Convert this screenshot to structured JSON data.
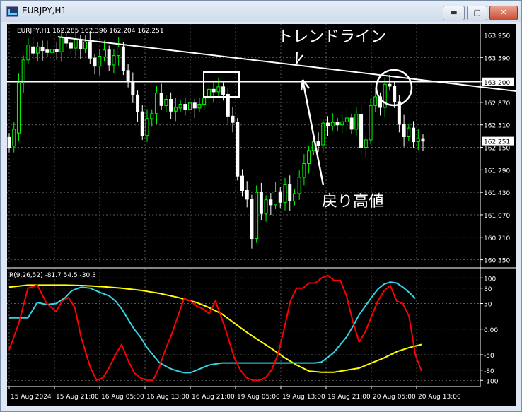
{
  "window": {
    "title": "EURJPY,H1",
    "min_symbol": "▬",
    "max_symbol": "▢",
    "close_symbol": "✕"
  },
  "colors": {
    "background": "#000000",
    "grid": "#7d7d7d",
    "bull": "#00ff00",
    "bear": "#ffffff",
    "line": "#ffffff",
    "red": "#ff0000",
    "cyan": "#33d6e6",
    "yellow": "#ffff00"
  },
  "chart": {
    "info": "EURJPY,H1  162.285 162.396 162.204 162.251",
    "price_ticks": [
      "163.950",
      "163.590",
      "163.200",
      "162.870",
      "162.510",
      "162.251",
      "162.150",
      "161.790",
      "161.430",
      "161.070",
      "160.710",
      "160.350"
    ],
    "annotations": {
      "trendline_label": "トレンドライン",
      "pullback_label": "戻り高値"
    }
  },
  "indicator": {
    "info": "R(9,26,52) -81.7 54.5 -30.3",
    "ticks": [
      "100",
      "80",
      "50",
      "0.00",
      "-50",
      "-80",
      "-100"
    ]
  },
  "time_axis": {
    "labels": [
      "15 Aug 2024",
      "15 Aug 21:00",
      "16 Aug 05:00",
      "16 Aug 13:00",
      "16 Aug 21:00",
      "19 Aug 05:00",
      "19 Aug 13:00",
      "19 Aug 21:00",
      "20 Aug 05:00",
      "20 Aug 13:00"
    ]
  },
  "chart_data": {
    "type": "candlestick",
    "symbol": "EURJPY",
    "timeframe": "H1",
    "last_price": 162.251,
    "levels": [
      163.2
    ],
    "candles": [
      [
        162.31,
        162.14
      ],
      [
        162.17,
        162.44
      ],
      [
        162.38,
        163.18
      ],
      [
        163.18,
        163.55
      ],
      [
        163.55,
        163.79
      ],
      [
        163.76,
        163.66
      ],
      [
        163.66,
        163.76
      ],
      [
        163.75,
        163.7
      ],
      [
        163.71,
        163.67
      ],
      [
        163.67,
        163.72
      ],
      [
        163.72,
        163.68
      ],
      [
        163.68,
        163.92
      ],
      [
        163.91,
        163.82
      ],
      [
        163.82,
        163.74
      ],
      [
        163.74,
        163.88
      ],
      [
        163.88,
        163.73
      ],
      [
        163.73,
        163.84
      ],
      [
        163.84,
        163.58
      ],
      [
        163.58,
        163.45
      ],
      [
        163.45,
        163.61
      ],
      [
        163.6,
        163.71
      ],
      [
        163.71,
        163.47
      ],
      [
        163.47,
        163.62
      ],
      [
        163.62,
        163.76
      ],
      [
        163.76,
        163.38
      ],
      [
        163.38,
        163.21
      ],
      [
        163.2,
        162.99
      ],
      [
        162.99,
        162.72
      ],
      [
        162.72,
        162.34
      ],
      [
        162.34,
        162.61
      ],
      [
        162.61,
        162.69
      ],
      [
        162.69,
        163.02
      ],
      [
        163.02,
        162.82
      ],
      [
        162.82,
        162.92
      ],
      [
        162.92,
        162.73
      ],
      [
        162.73,
        162.79
      ],
      [
        162.78,
        162.84
      ],
      [
        162.84,
        162.76
      ],
      [
        162.76,
        162.86
      ],
      [
        162.86,
        162.78
      ],
      [
        162.78,
        162.84
      ],
      [
        162.84,
        162.94
      ],
      [
        162.94,
        163.08
      ],
      [
        163.08,
        163.04
      ],
      [
        163.04,
        163.12
      ],
      [
        163.12,
        163.0
      ],
      [
        163.0,
        162.65
      ],
      [
        162.65,
        162.55
      ],
      [
        162.55,
        161.69
      ],
      [
        161.69,
        161.46
      ],
      [
        161.46,
        161.32
      ],
      [
        161.32,
        160.69
      ],
      [
        160.69,
        161.43
      ],
      [
        161.43,
        161.09
      ],
      [
        161.09,
        161.31
      ],
      [
        161.31,
        161.23
      ],
      [
        161.23,
        161.44
      ],
      [
        161.44,
        161.27
      ],
      [
        161.27,
        161.55
      ],
      [
        161.55,
        161.29
      ],
      [
        161.29,
        161.41
      ],
      [
        161.41,
        161.67
      ],
      [
        161.67,
        161.89
      ],
      [
        161.89,
        162.1
      ],
      [
        162.1,
        162.24
      ],
      [
        162.24,
        162.18
      ],
      [
        162.19,
        162.54
      ],
      [
        162.54,
        162.49
      ],
      [
        162.49,
        162.55
      ],
      [
        162.55,
        162.51
      ],
      [
        162.51,
        162.56
      ],
      [
        162.56,
        162.62
      ],
      [
        162.62,
        162.44
      ],
      [
        162.44,
        162.68
      ],
      [
        162.68,
        162.15
      ],
      [
        162.15,
        162.27
      ],
      [
        162.27,
        162.82
      ],
      [
        162.82,
        162.96
      ],
      [
        162.96,
        162.79
      ],
      [
        162.79,
        163.16
      ],
      [
        163.16,
        163.13
      ],
      [
        163.13,
        162.88
      ],
      [
        162.88,
        162.52
      ],
      [
        162.52,
        162.32
      ],
      [
        162.32,
        162.46
      ],
      [
        162.46,
        162.24
      ],
      [
        162.24,
        162.29
      ],
      [
        162.29,
        162.25
      ]
    ],
    "trendline": {
      "from": [
        0.1,
        163.92
      ],
      "to": [
        1.0,
        163.05
      ]
    },
    "indicator": {
      "name": "R(9,26,52)",
      "values": {
        "r9": -81.7,
        "r26": 54.5,
        "r52": -30.3
      },
      "red": [
        [
          0,
          -40
        ],
        [
          3,
          10
        ],
        [
          6,
          80
        ],
        [
          9,
          86
        ],
        [
          12,
          50
        ],
        [
          15,
          35
        ],
        [
          17,
          55
        ],
        [
          19,
          62
        ],
        [
          21,
          42
        ],
        [
          23,
          -15
        ],
        [
          26,
          -75
        ],
        [
          28,
          -100
        ],
        [
          30,
          -95
        ],
        [
          32,
          -75
        ],
        [
          34,
          -50
        ],
        [
          36,
          -30
        ],
        [
          38,
          -60
        ],
        [
          40,
          -85
        ],
        [
          42,
          -95
        ],
        [
          44,
          -100
        ],
        [
          46,
          -100
        ],
        [
          48,
          -75
        ],
        [
          50,
          -40
        ],
        [
          52,
          -10
        ],
        [
          54,
          25
        ],
        [
          56,
          60
        ],
        [
          58,
          55
        ],
        [
          60,
          45
        ],
        [
          62,
          40
        ],
        [
          64,
          30
        ],
        [
          66,
          55
        ],
        [
          68,
          22
        ],
        [
          70,
          -15
        ],
        [
          72,
          -55
        ],
        [
          74,
          -80
        ],
        [
          76,
          -95
        ],
        [
          78,
          -100
        ],
        [
          80,
          -100
        ],
        [
          82,
          -95
        ],
        [
          84,
          -80
        ],
        [
          86,
          -50
        ],
        [
          88,
          0
        ],
        [
          90,
          55
        ],
        [
          92,
          80
        ],
        [
          94,
          80
        ],
        [
          96,
          90
        ],
        [
          98,
          90
        ],
        [
          100,
          100
        ],
        [
          102,
          105
        ],
        [
          104,
          95
        ],
        [
          106,
          95
        ],
        [
          108,
          65
        ],
        [
          110,
          15
        ],
        [
          112,
          -25
        ],
        [
          114,
          -5
        ],
        [
          116,
          25
        ],
        [
          118,
          55
        ],
        [
          120,
          75
        ],
        [
          122,
          85
        ],
        [
          124,
          55
        ],
        [
          126,
          50
        ],
        [
          128,
          25
        ],
        [
          130,
          -50
        ],
        [
          132,
          -82
        ]
      ],
      "cyan": [
        [
          0,
          22
        ],
        [
          3,
          22
        ],
        [
          6,
          22
        ],
        [
          9,
          52
        ],
        [
          12,
          48
        ],
        [
          15,
          50
        ],
        [
          18,
          62
        ],
        [
          20,
          75
        ],
        [
          23,
          82
        ],
        [
          26,
          80
        ],
        [
          29,
          72
        ],
        [
          32,
          65
        ],
        [
          34,
          55
        ],
        [
          36,
          40
        ],
        [
          38,
          20
        ],
        [
          40,
          0
        ],
        [
          42,
          -15
        ],
        [
          44,
          -35
        ],
        [
          46,
          -50
        ],
        [
          48,
          -65
        ],
        [
          50,
          -72
        ],
        [
          52,
          -78
        ],
        [
          54,
          -82
        ],
        [
          56,
          -85
        ],
        [
          58,
          -85
        ],
        [
          60,
          -80
        ],
        [
          62,
          -75
        ],
        [
          64,
          -70
        ],
        [
          66,
          -68
        ],
        [
          68,
          -66
        ],
        [
          70,
          -66
        ],
        [
          72,
          -66
        ],
        [
          74,
          -66
        ],
        [
          76,
          -66
        ],
        [
          78,
          -66
        ],
        [
          80,
          -66
        ],
        [
          82,
          -66
        ],
        [
          84,
          -66
        ],
        [
          86,
          -66
        ],
        [
          88,
          -66
        ],
        [
          90,
          -66
        ],
        [
          92,
          -66
        ],
        [
          94,
          -66
        ],
        [
          96,
          -66
        ],
        [
          98,
          -66
        ],
        [
          100,
          -64
        ],
        [
          102,
          -55
        ],
        [
          104,
          -45
        ],
        [
          106,
          -30
        ],
        [
          108,
          -15
        ],
        [
          110,
          5
        ],
        [
          112,
          28
        ],
        [
          114,
          45
        ],
        [
          116,
          62
        ],
        [
          118,
          78
        ],
        [
          120,
          88
        ],
        [
          122,
          92
        ],
        [
          124,
          90
        ],
        [
          126,
          82
        ],
        [
          128,
          72
        ],
        [
          130,
          60
        ]
      ],
      "yellow": [
        [
          0,
          82
        ],
        [
          6,
          86
        ],
        [
          12,
          86
        ],
        [
          18,
          86
        ],
        [
          24,
          85
        ],
        [
          30,
          83
        ],
        [
          36,
          80
        ],
        [
          42,
          76
        ],
        [
          48,
          70
        ],
        [
          54,
          62
        ],
        [
          60,
          52
        ],
        [
          64,
          42
        ],
        [
          68,
          30
        ],
        [
          72,
          12
        ],
        [
          76,
          -6
        ],
        [
          80,
          -22
        ],
        [
          84,
          -38
        ],
        [
          88,
          -55
        ],
        [
          92,
          -70
        ],
        [
          96,
          -82
        ],
        [
          100,
          -84
        ],
        [
          104,
          -84
        ],
        [
          108,
          -80
        ],
        [
          112,
          -76
        ],
        [
          116,
          -66
        ],
        [
          120,
          -56
        ],
        [
          124,
          -44
        ],
        [
          128,
          -36
        ],
        [
          132,
          -30
        ]
      ]
    }
  }
}
